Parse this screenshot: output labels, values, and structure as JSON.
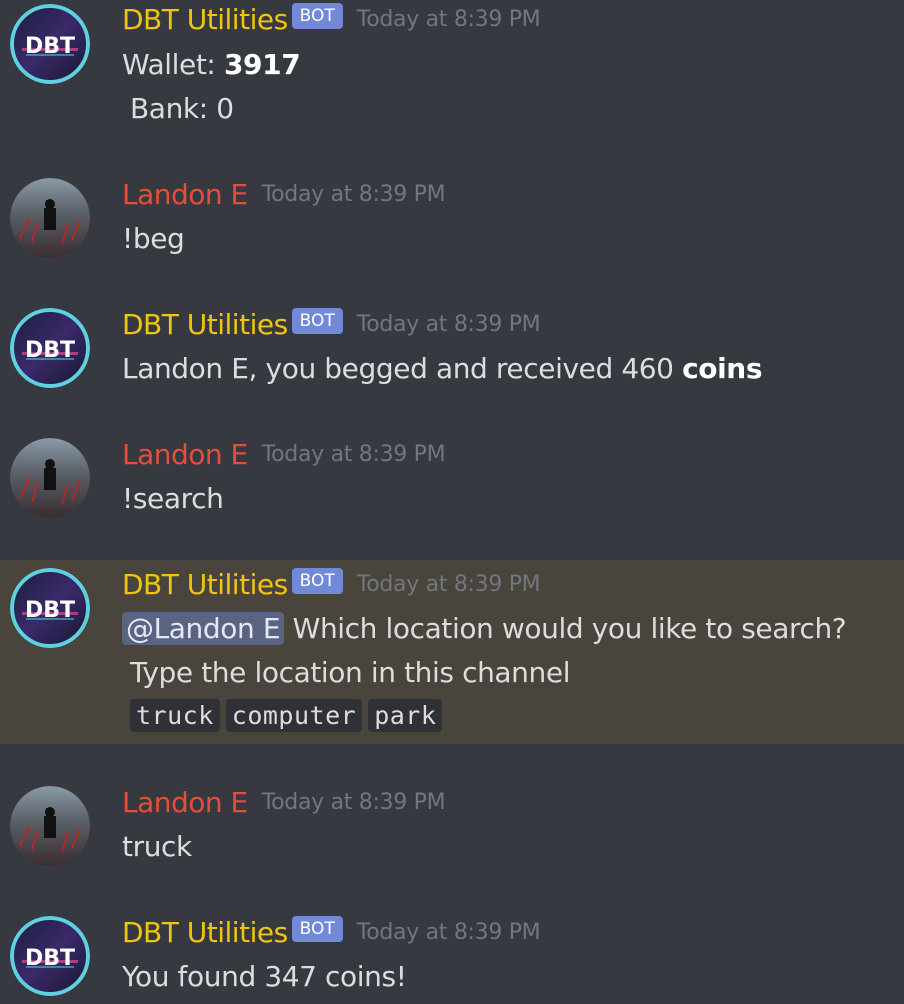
{
  "bot": {
    "name": "DBT Utilities",
    "badge": "BOT",
    "avatar_text": "DBT"
  },
  "user": {
    "name": "Landon E"
  },
  "messages": [
    {
      "timestamp": "Today at 8:39 PM",
      "wallet_label": "Wallet: ",
      "wallet_value": "3917",
      "bank_text": "Bank: 0"
    },
    {
      "timestamp": "Today at 8:39 PM",
      "text": "!beg"
    },
    {
      "timestamp": "Today at 8:39 PM",
      "text_prefix": "Landon E, you begged and received 460 ",
      "text_bold": "coins"
    },
    {
      "timestamp": "Today at 8:39 PM",
      "text": "!search"
    },
    {
      "timestamp": "Today at 8:39 PM",
      "mention": "@Landon E",
      "text_line1": " Which location would you like to search?",
      "text_line2": "Type the location in this channel",
      "options": [
        "truck",
        "computer",
        "park"
      ]
    },
    {
      "timestamp": "Today at 8:39 PM",
      "text": "truck"
    },
    {
      "timestamp": "Today at 8:39 PM",
      "text": "You found 347 coins!"
    }
  ],
  "colors": {
    "background": "#36393f",
    "mention_highlight": "#49443c",
    "bot_name": "#f1c40f",
    "user_name": "#e74c3c",
    "badge": "#7289da",
    "timestamp": "#72767d"
  }
}
